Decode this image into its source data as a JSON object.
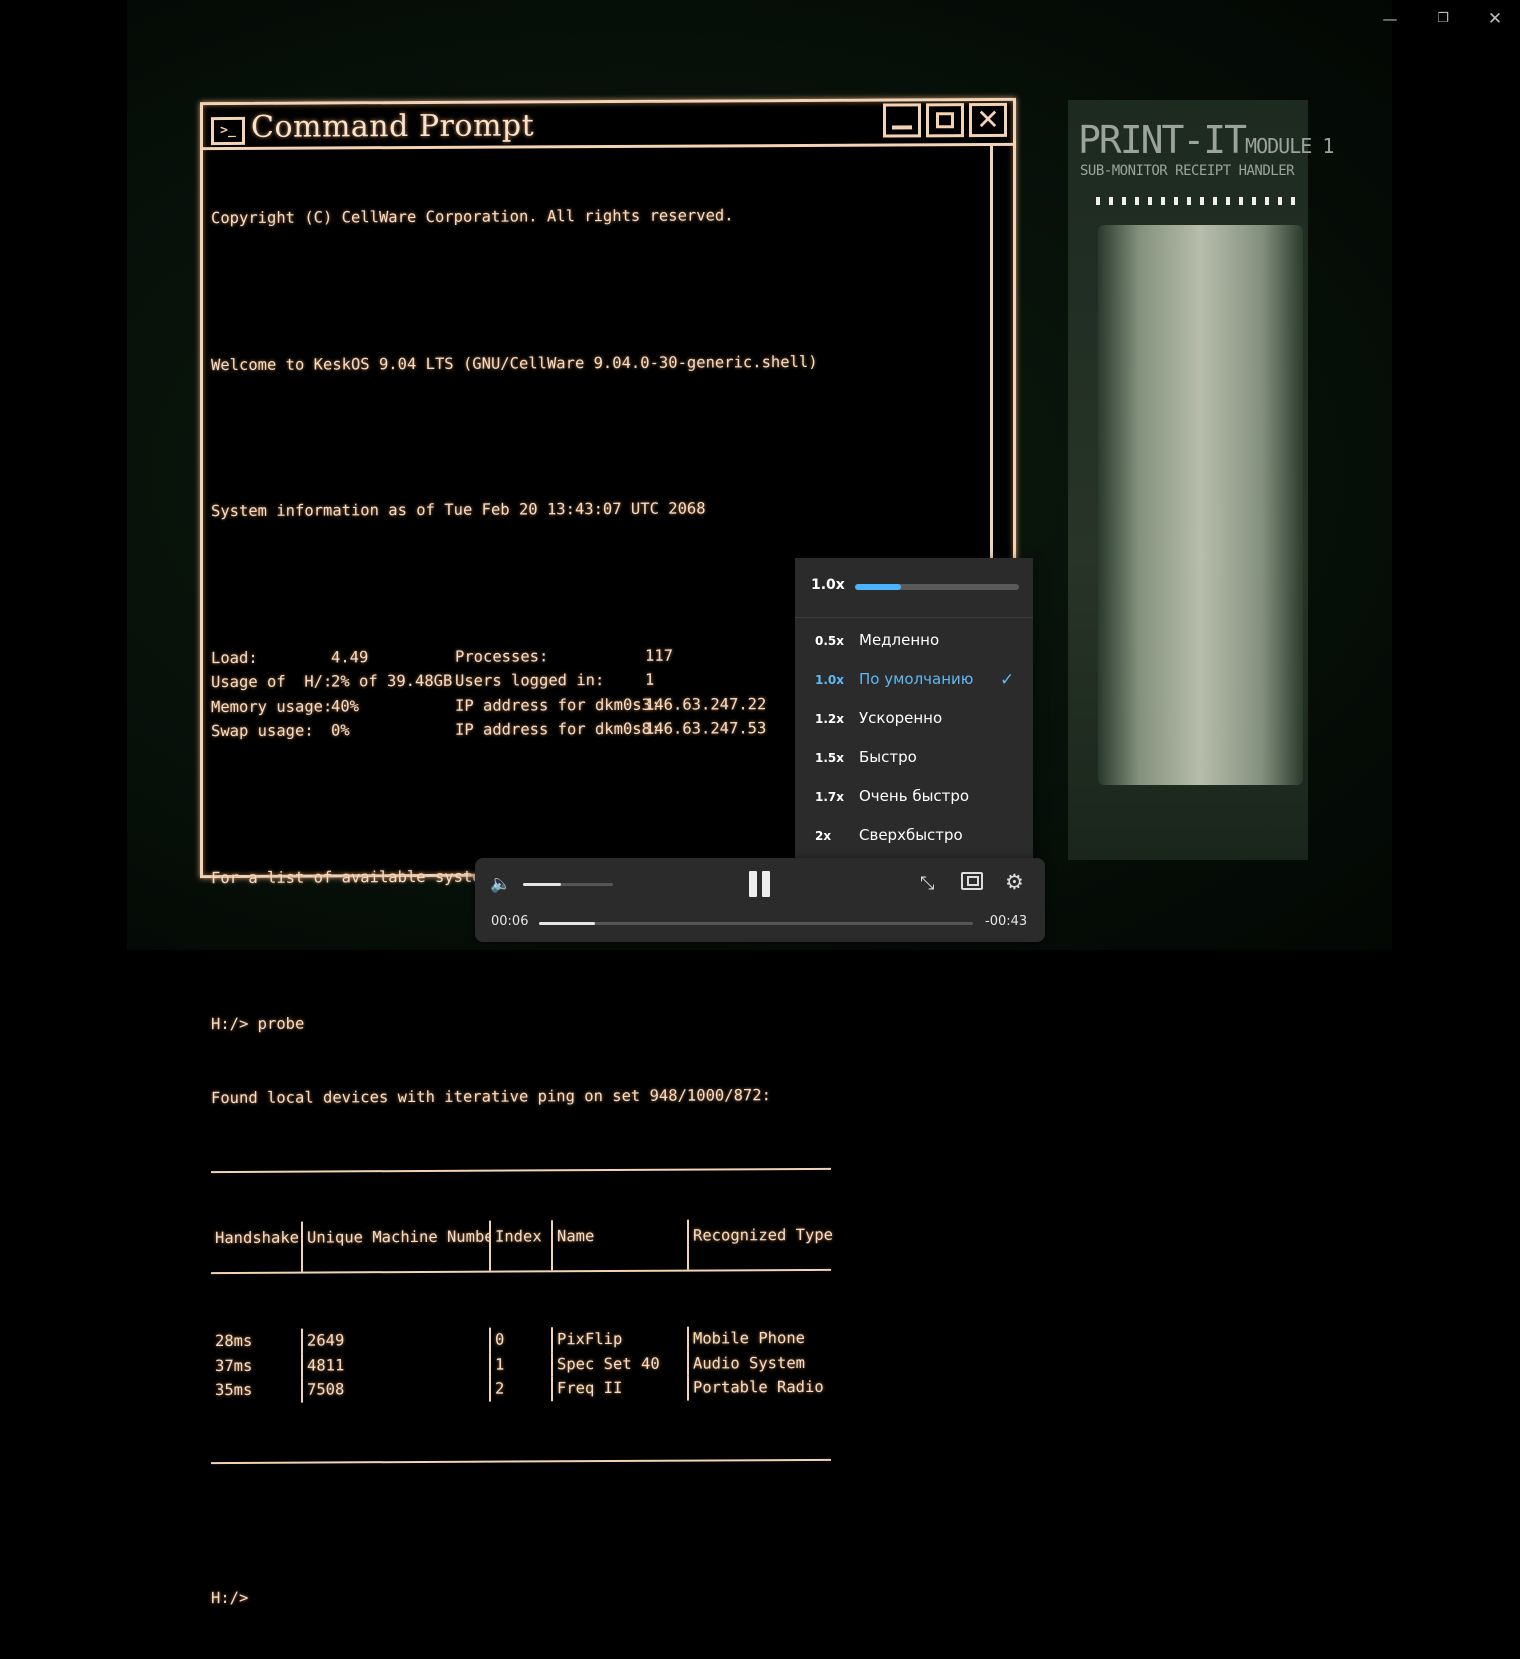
{
  "window": {
    "minimize_icon": "—",
    "restore_icon": "❐",
    "close_icon": "✕"
  },
  "terminal": {
    "title_icon": ">_",
    "title": "Command Prompt",
    "close_glyph": "✕",
    "copyright": "Copyright (C) CellWare Corporation. All rights reserved.",
    "welcome": "Welcome to KeskOS 9.04 LTS (GNU/CellWare 9.04.0-30-generic.shell)",
    "sysinfo": "System information as of Tue Feb 20 13:43:07 UTC 2068",
    "stats": [
      {
        "label": "Load:",
        "value": "4.49",
        "label2": "Processes:",
        "value2": "117"
      },
      {
        "label": "Usage of  H/:",
        "value": "2% of 39.48GB",
        "label2": "Users logged in:",
        "value2": "1"
      },
      {
        "label": "Memory usage:",
        "value": "40%",
        "label2": "IP address for dkm0s3:",
        "value2": "146.63.247.22"
      },
      {
        "label": "Swap usage:",
        "value": "0%",
        "label2": "IP address for dkm0s8:",
        "value2": "146.63.247.53"
      }
    ],
    "help_line": "For a list of available system commands, return 'help'.",
    "command": "H:/> probe",
    "found_line": "Found local devices with iterative ping on set 948/1000/872:",
    "table": {
      "headers": [
        "Handshake",
        "Unique Machine Number",
        "Index",
        "Name",
        "Recognized Type"
      ],
      "rows": [
        [
          "28ms",
          "2649",
          "0",
          "PixFlip",
          "Mobile Phone"
        ],
        [
          "37ms",
          "4811",
          "1",
          "Spec Set 40",
          "Audio System"
        ],
        [
          "35ms",
          "7508",
          "2",
          "Freq II",
          "Portable Radio"
        ]
      ]
    },
    "prompt": "H:/>"
  },
  "printer": {
    "label": "PRINT-IT",
    "module": "MODULE 1",
    "sub": "SUB-MONITOR RECEIPT HANDLER"
  },
  "speed_menu": {
    "current": "1.0x",
    "slider_fraction": 0.28,
    "items": [
      {
        "code": "0.5x",
        "label": "Медленно",
        "selected": false
      },
      {
        "code": "1.0x",
        "label": "По умолчанию",
        "selected": true
      },
      {
        "code": "1.2x",
        "label": "Ускоренно",
        "selected": false
      },
      {
        "code": "1.5x",
        "label": "Быстро",
        "selected": false
      },
      {
        "code": "1.7x",
        "label": "Очень быстро",
        "selected": false
      },
      {
        "code": "2x",
        "label": "Сверхбыстро",
        "selected": false
      }
    ],
    "check_icon": "✓"
  },
  "player": {
    "volume_icon": "🔈",
    "volume_fraction": 0.42,
    "compact_icon": "⤡",
    "settings_icon": "⚙",
    "elapsed": "00:06",
    "remaining": "-00:43",
    "progress_fraction": 0.13
  }
}
